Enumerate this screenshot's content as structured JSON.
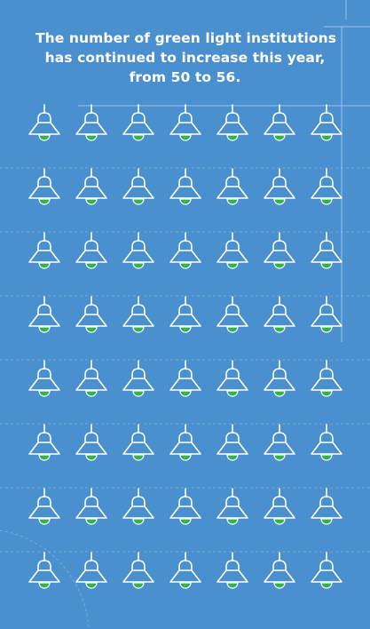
{
  "headline": {
    "line1": "The number of green light institutions",
    "line2": "has continued to increase this year,",
    "line3": "from 50 to 56."
  },
  "icon_grid": {
    "icon": "pendant-lamp-icon",
    "rows": 8,
    "columns": 7,
    "lit_count": 56
  },
  "colors": {
    "background": "#4a90cf",
    "lamp_outline": "#ffffff",
    "bulb_lit": "#2fb34a",
    "grid_line": "#8fbfe6"
  }
}
